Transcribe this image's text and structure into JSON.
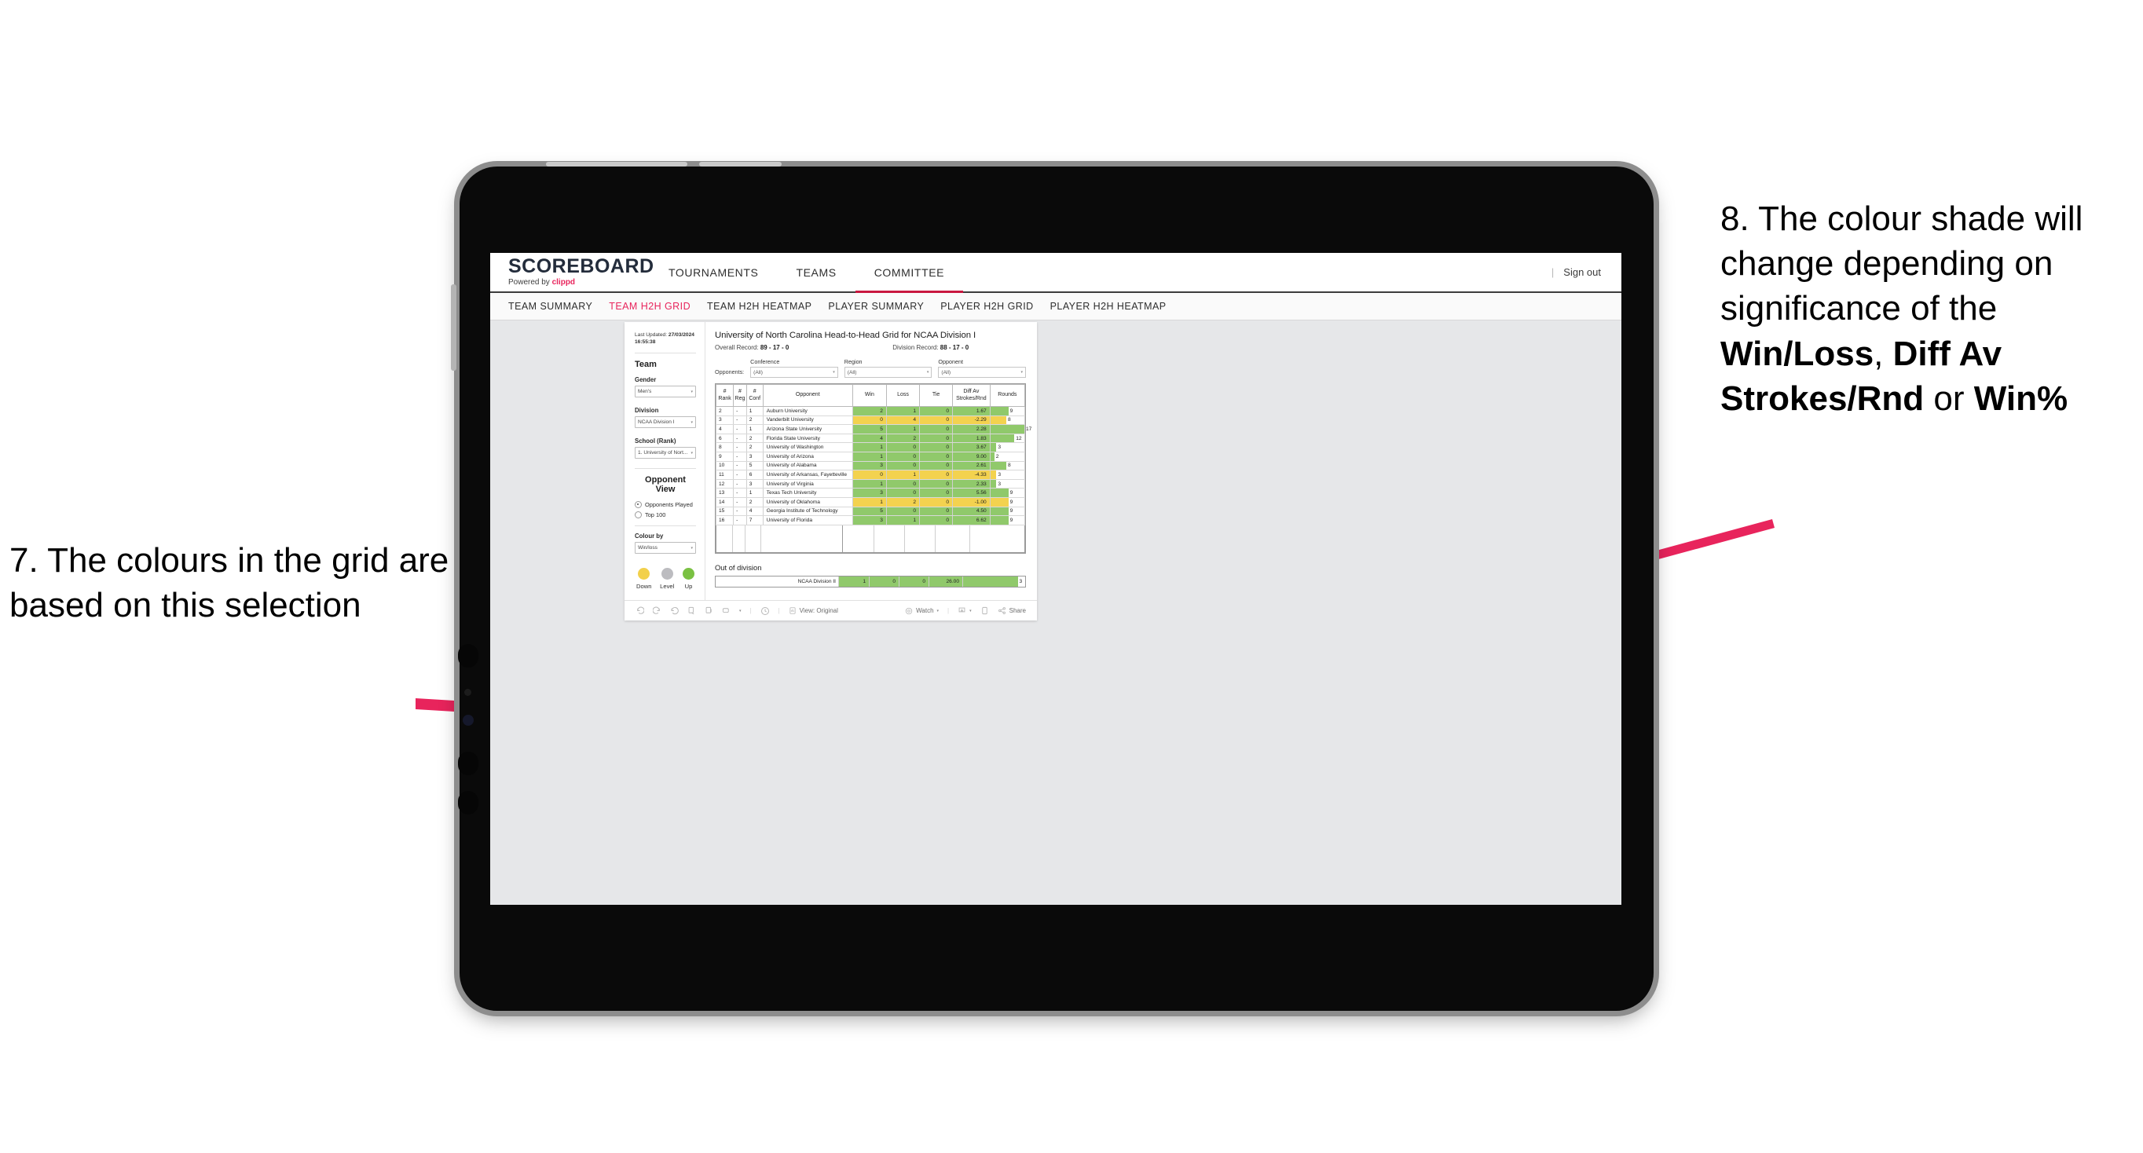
{
  "annotations": {
    "left": {
      "id": "7.",
      "text": "7. The colours in the grid are based on this selection"
    },
    "right": {
      "lead": "8. The colour shade will change depending on significance of the ",
      "bold1": "Win/Loss",
      "mid1": ", ",
      "bold2": "Diff Av Strokes/Rnd",
      "mid2": " or ",
      "bold3": "Win%"
    },
    "arrow_color": "#E8245C"
  },
  "app": {
    "logo": {
      "main": "SCOREBOARD",
      "powered_prefix": "Powered by ",
      "brand": "clippd"
    },
    "top_nav": [
      {
        "label": "TOURNAMENTS",
        "active": false
      },
      {
        "label": "TEAMS",
        "active": false
      },
      {
        "label": "COMMITTEE",
        "active": true
      }
    ],
    "sign_out": "Sign out",
    "divider": "|",
    "sub_nav": [
      {
        "label": "TEAM SUMMARY",
        "active": false
      },
      {
        "label": "TEAM H2H GRID",
        "active": true
      },
      {
        "label": "TEAM H2H HEATMAP",
        "active": false
      },
      {
        "label": "PLAYER SUMMARY",
        "active": false
      },
      {
        "label": "PLAYER H2H GRID",
        "active": false
      },
      {
        "label": "PLAYER H2H HEATMAP",
        "active": false
      }
    ]
  },
  "sidebar": {
    "last_updated_label": "Last Updated:",
    "last_updated_date": "27/03/2024",
    "last_updated_time": "16:55:38",
    "team_heading": "Team",
    "gender_label": "Gender",
    "gender_value": "Men's",
    "division_label": "Division",
    "division_value": "NCAA Division I",
    "school_label": "School (Rank)",
    "school_value": "1. University of Nort...",
    "opponent_view_heading": "Opponent View",
    "radio_played": "Opponents Played",
    "radio_top100": "Top 100",
    "colour_by_label": "Colour by",
    "colour_by_value": "Win/loss",
    "legend": [
      {
        "label": "Down",
        "color": "#f2d04b"
      },
      {
        "label": "Level",
        "color": "#bcbcc0"
      },
      {
        "label": "Up",
        "color": "#7ac143"
      }
    ]
  },
  "main": {
    "title": "University of North Carolina Head-to-Head Grid for NCAA Division I",
    "overall_record_label": "Overall Record:",
    "overall_record_value": "89 - 17 - 0",
    "division_record_label": "Division Record:",
    "division_record_value": "88 - 17 - 0",
    "opponents_label": "Opponents:",
    "filters": [
      {
        "label": "Conference",
        "value": "(All)"
      },
      {
        "label": "Region",
        "value": "(All)"
      },
      {
        "label": "Opponent",
        "value": "(All)"
      }
    ],
    "out_of_division_title": "Out of division"
  },
  "chart_data": {
    "type": "table",
    "title": "University of North Carolina Head-to-Head Grid for NCAA Division I",
    "columns": [
      "# Rank",
      "# Reg",
      "# Conf",
      "Opponent",
      "Win",
      "Loss",
      "Tie",
      "Diff Av Strokes/Rnd",
      "Rounds"
    ],
    "column_headers_multiline": [
      {
        "l1": "#",
        "l2": "Rank"
      },
      {
        "l1": "#",
        "l2": "Reg"
      },
      {
        "l1": "#",
        "l2": "Conf"
      },
      {
        "l1": "Opponent",
        "l2": ""
      },
      {
        "l1": "Win",
        "l2": ""
      },
      {
        "l1": "Loss",
        "l2": ""
      },
      {
        "l1": "Tie",
        "l2": ""
      },
      {
        "l1": "Diff Av",
        "l2": "Strokes/Rnd"
      },
      {
        "l1": "Rounds",
        "l2": ""
      }
    ],
    "rounds_max": 17,
    "colors": {
      "up": "#90c96b",
      "down": "#f3d24f",
      "level": "#bcbcc0"
    },
    "rows": [
      {
        "rank": "2",
        "reg": "-",
        "conf": "1",
        "opponent": "Auburn University",
        "win": "2",
        "loss": "1",
        "tie": "0",
        "diff": "1.67",
        "rounds": "9",
        "status": "up"
      },
      {
        "rank": "3",
        "reg": "-",
        "conf": "2",
        "opponent": "Vanderbilt University",
        "win": "0",
        "loss": "4",
        "tie": "0",
        "diff": "-2.29",
        "rounds": "8",
        "status": "down"
      },
      {
        "rank": "4",
        "reg": "-",
        "conf": "1",
        "opponent": "Arizona State University",
        "win": "5",
        "loss": "1",
        "tie": "0",
        "diff": "2.28",
        "rounds": "17",
        "status": "up"
      },
      {
        "rank": "6",
        "reg": "-",
        "conf": "2",
        "opponent": "Florida State University",
        "win": "4",
        "loss": "2",
        "tie": "0",
        "diff": "1.83",
        "rounds": "12",
        "status": "up"
      },
      {
        "rank": "8",
        "reg": "-",
        "conf": "2",
        "opponent": "University of Washington",
        "win": "1",
        "loss": "0",
        "tie": "0",
        "diff": "3.67",
        "rounds": "3",
        "status": "up"
      },
      {
        "rank": "9",
        "reg": "-",
        "conf": "3",
        "opponent": "University of Arizona",
        "win": "1",
        "loss": "0",
        "tie": "0",
        "diff": "9.00",
        "rounds": "2",
        "status": "up"
      },
      {
        "rank": "10",
        "reg": "-",
        "conf": "5",
        "opponent": "University of Alabama",
        "win": "3",
        "loss": "0",
        "tie": "0",
        "diff": "2.61",
        "rounds": "8",
        "status": "up"
      },
      {
        "rank": "11",
        "reg": "-",
        "conf": "6",
        "opponent": "University of Arkansas, Fayetteville",
        "win": "0",
        "loss": "1",
        "tie": "0",
        "diff": "-4.33",
        "rounds": "3",
        "status": "down"
      },
      {
        "rank": "12",
        "reg": "-",
        "conf": "3",
        "opponent": "University of Virginia",
        "win": "1",
        "loss": "0",
        "tie": "0",
        "diff": "2.33",
        "rounds": "3",
        "status": "up"
      },
      {
        "rank": "13",
        "reg": "-",
        "conf": "1",
        "opponent": "Texas Tech University",
        "win": "3",
        "loss": "0",
        "tie": "0",
        "diff": "5.56",
        "rounds": "9",
        "status": "up"
      },
      {
        "rank": "14",
        "reg": "-",
        "conf": "2",
        "opponent": "University of Oklahoma",
        "win": "1",
        "loss": "2",
        "tie": "0",
        "diff": "-1.00",
        "rounds": "9",
        "status": "down"
      },
      {
        "rank": "15",
        "reg": "-",
        "conf": "4",
        "opponent": "Georgia Institute of Technology",
        "win": "5",
        "loss": "0",
        "tie": "0",
        "diff": "4.50",
        "rounds": "9",
        "status": "up"
      },
      {
        "rank": "16",
        "reg": "-",
        "conf": "7",
        "opponent": "University of Florida",
        "win": "3",
        "loss": "1",
        "tie": "0",
        "diff": "6.62",
        "rounds": "9",
        "status": "up"
      }
    ],
    "out_of_division": {
      "label": "NCAA Division II",
      "win": "1",
      "loss": "0",
      "tie": "0",
      "diff": "26.00",
      "rounds": "3",
      "status": "up"
    }
  },
  "toolbar": {
    "view_label": "View: Original",
    "watch_label": "Watch",
    "share_label": "Share"
  }
}
